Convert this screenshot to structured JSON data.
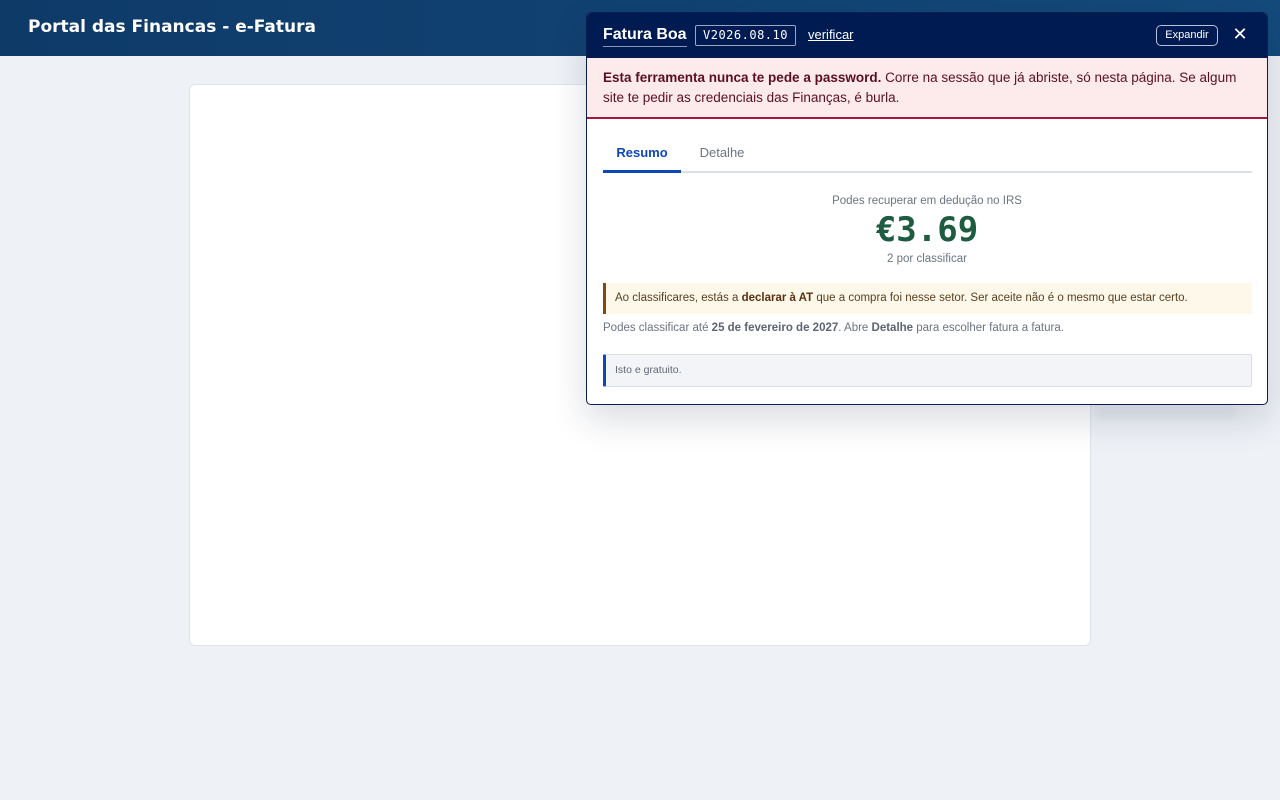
{
  "portal": {
    "title": "Portal das Financas - e-Fatura"
  },
  "panel": {
    "title": "Fatura Boa",
    "version": "V2026.08.10",
    "verify_label": "verificar",
    "expand_label": "Expandir",
    "close_label": "✕",
    "warning": {
      "strong": "Esta ferramenta nunca te pede a password.",
      "text": " Corre na sessão que já abriste, só nesta página. Se algum site te pedir as credenciais das Finanças, é burla."
    },
    "tabs": [
      {
        "label": "Resumo",
        "active": true
      },
      {
        "label": "Detalhe",
        "active": false
      }
    ],
    "summary": {
      "caption": "Podes recuperar em dedução no IRS",
      "amount": "€3.69",
      "pending": "2 por classificar"
    },
    "note": {
      "prefix": "Ao classificares, estás a ",
      "strong": "declarar à AT",
      "suffix": " que a compra foi nesse setor. Ser aceite não é o mesmo que estar certo."
    },
    "deadline": {
      "prefix": "Podes classificar até ",
      "date": "25 de fevereiro de 2027",
      "middle": ". Abre ",
      "detail": "Detalhe",
      "suffix": " para escolher fatura a fatura."
    },
    "info": "Isto e gratuito."
  },
  "colors": {
    "header_bg": "#0e3a68",
    "panel_header_bg": "#001a52",
    "warning_bg": "#fdeaea",
    "warning_border": "#a8173a",
    "accent": "#0d47b8",
    "amount": "#1e5c40"
  }
}
